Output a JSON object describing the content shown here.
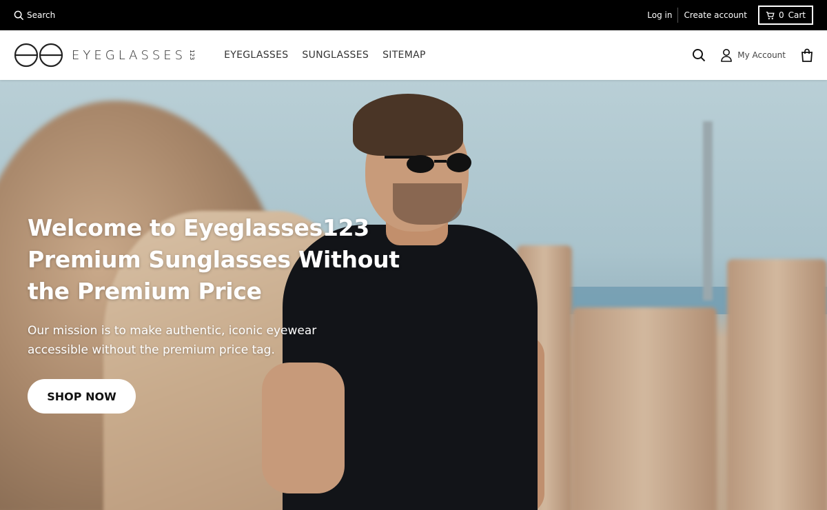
{
  "topbar": {
    "search_label": "Search",
    "login_label": "Log in",
    "create_account_label": "Create account",
    "cart_count": "0",
    "cart_label": "Cart"
  },
  "header": {
    "logo_text": "EYEGLASSES",
    "logo_sup": "123",
    "nav": [
      {
        "label": "EYEGLASSES"
      },
      {
        "label": "SUNGLASSES"
      },
      {
        "label": "SITEMAP"
      }
    ],
    "account_label": "My Account",
    "icons": [
      "search-icon",
      "user-icon",
      "bag-icon"
    ]
  },
  "hero": {
    "title_line1": "Welcome to Eyeglasses123",
    "title_line2": "Premium Sunglasses Without",
    "title_line3": "the Premium Price",
    "subtitle": "Our mission is to make authentic, iconic eyewear accessible without the premium price tag.",
    "cta_label": "SHOP NOW"
  },
  "colors": {
    "topbar_bg": "#000000",
    "header_bg": "#ffffff",
    "cta_bg": "#ffffff",
    "text_light": "#ffffff"
  }
}
